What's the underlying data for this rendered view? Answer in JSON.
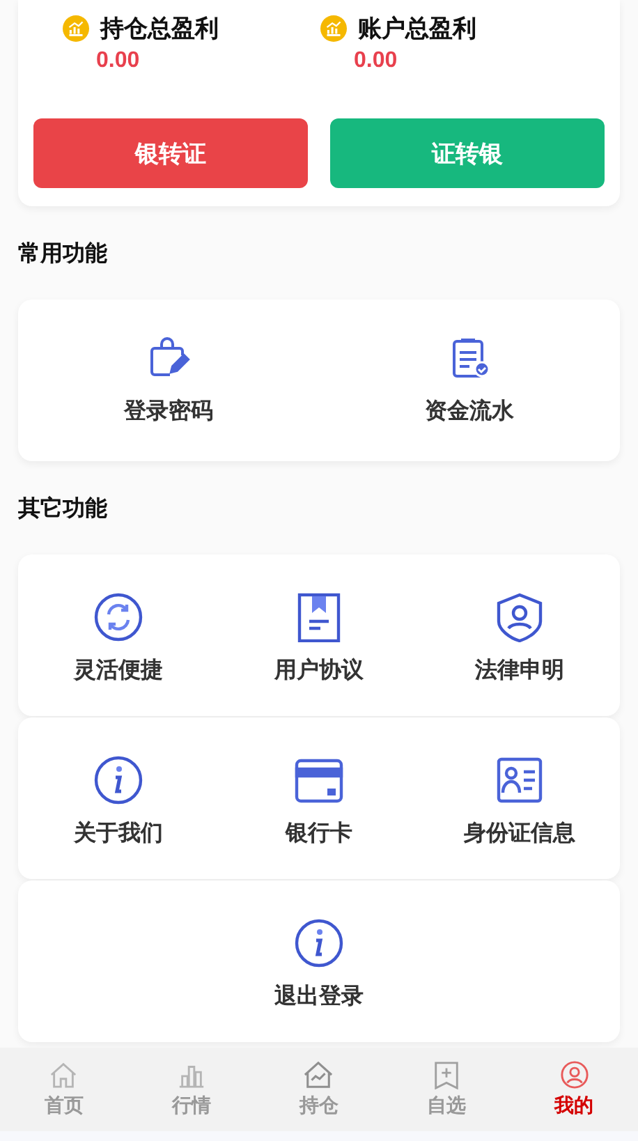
{
  "summary": {
    "stats": [
      {
        "label": "持仓总盈利",
        "value": "0.00"
      },
      {
        "label": "账户总盈利",
        "value": "0.00"
      }
    ],
    "buttons": [
      {
        "label": "银转证",
        "kind": "in"
      },
      {
        "label": "证转银",
        "kind": "out"
      }
    ]
  },
  "common_functions": {
    "title": "常用功能",
    "items": [
      {
        "label": "登录密码"
      },
      {
        "label": "资金流水"
      }
    ]
  },
  "other_functions": {
    "title": "其它功能",
    "rows": [
      [
        {
          "label": "灵活便捷"
        },
        {
          "label": "用户协议"
        },
        {
          "label": "法律申明"
        }
      ],
      [
        {
          "label": "关于我们"
        },
        {
          "label": "银行卡"
        },
        {
          "label": "身份证信息"
        }
      ]
    ]
  },
  "logout": {
    "label": "退出登录"
  },
  "tab_bar": [
    {
      "label": "首页",
      "selected": false
    },
    {
      "label": "行情",
      "selected": false
    },
    {
      "label": "持仓",
      "selected": false
    },
    {
      "label": "自选",
      "selected": false
    },
    {
      "label": "我的",
      "selected": true
    }
  ]
}
